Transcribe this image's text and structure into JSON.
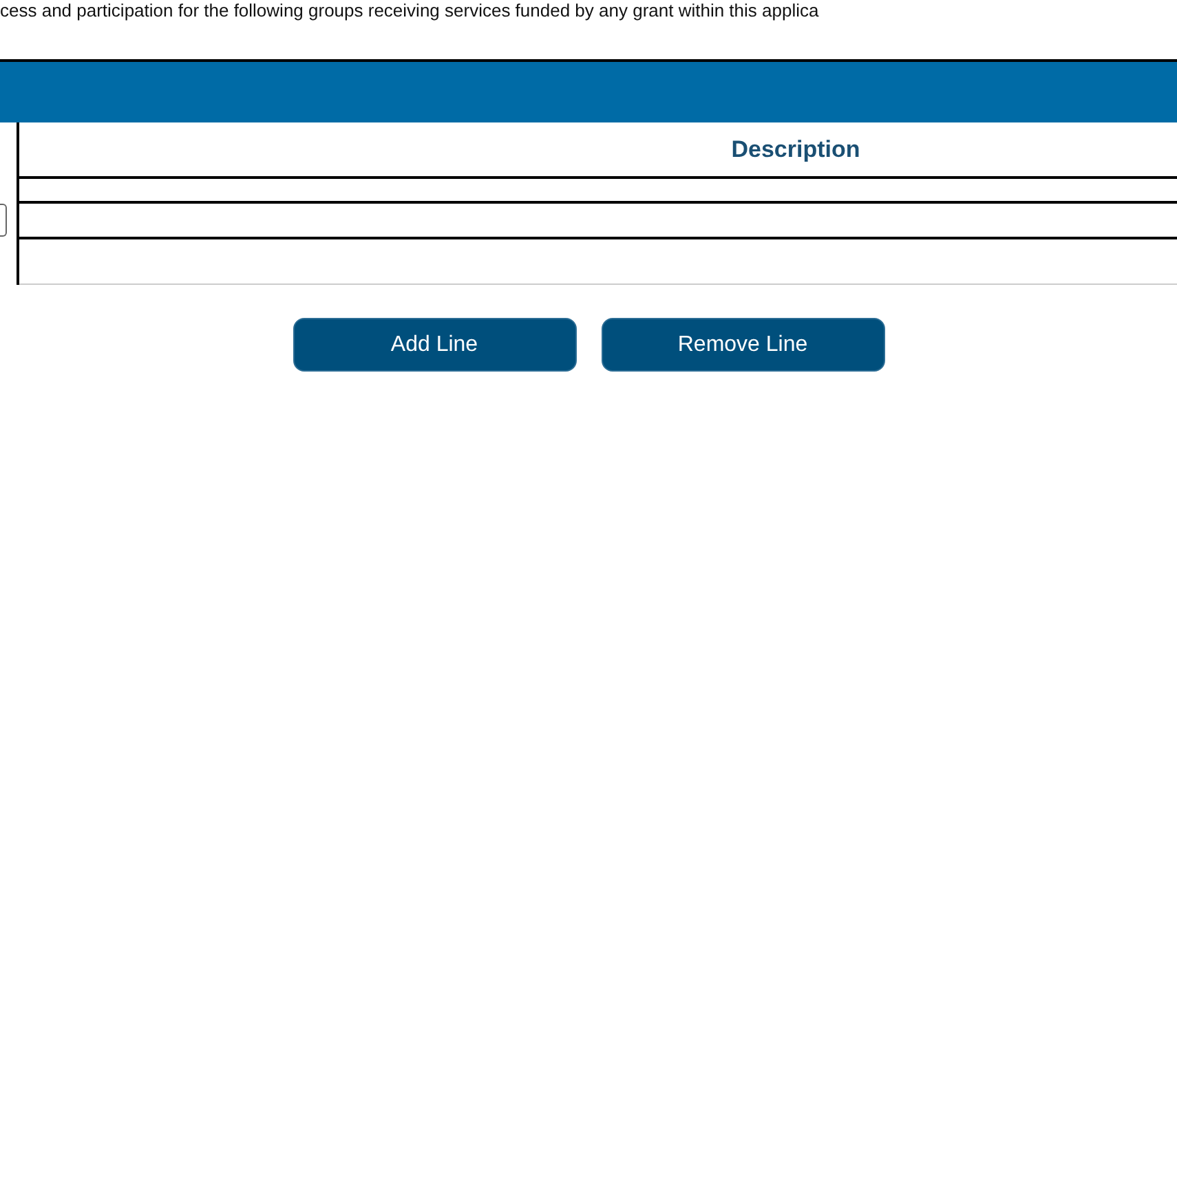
{
  "intro": "cess and participation for the following groups receiving services funded by any grant within this applica",
  "table": {
    "columns": [
      {
        "label": "Description"
      }
    ]
  },
  "buttons": [
    {
      "label": "Add Line"
    },
    {
      "label": "Remove Line"
    }
  ]
}
